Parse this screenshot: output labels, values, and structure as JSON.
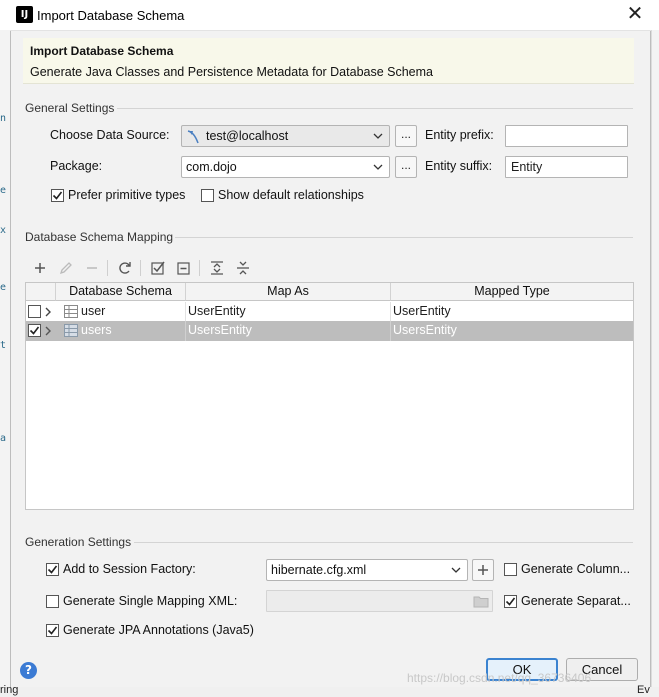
{
  "window": {
    "title": "Import Database Schema",
    "app_icon": "IJ"
  },
  "header": {
    "title": "Import Database Schema",
    "subtitle": "Generate Java Classes and Persistence Metadata for Database Schema"
  },
  "general": {
    "section_label": "General Settings",
    "data_source_label": "Choose Data Source:",
    "data_source_value": "test@localhost",
    "package_label": "Package:",
    "package_value": "com.dojo",
    "entity_prefix_label": "Entity prefix:",
    "entity_prefix_value": "",
    "entity_suffix_label": "Entity suffix:",
    "entity_suffix_value": "Entity",
    "browse_label": "...",
    "prefer_primitive_label": "Prefer primitive types",
    "prefer_primitive_checked": true,
    "show_relationships_label": "Show default relationships",
    "show_relationships_checked": false
  },
  "mapping": {
    "section_label": "Database Schema Mapping",
    "columns": [
      "Database Schema",
      "Map As",
      "Mapped Type"
    ],
    "rows": [
      {
        "checked": false,
        "name": "user",
        "map_as": "UserEntity",
        "mapped_type": "UserEntity",
        "selected": false
      },
      {
        "checked": true,
        "name": "users",
        "map_as": "UsersEntity",
        "mapped_type": "UsersEntity",
        "selected": true
      }
    ]
  },
  "generation": {
    "section_label": "Generation Settings",
    "session_factory_label": "Add to Session Factory:",
    "session_factory_checked": true,
    "session_factory_value": "hibernate.cfg.xml",
    "single_mapping_label": "Generate Single Mapping XML:",
    "single_mapping_checked": false,
    "single_mapping_value": "",
    "jpa_label": "Generate JPA Annotations (Java5)",
    "jpa_checked": true,
    "generate_column_label": "Generate Column...",
    "generate_column_checked": false,
    "generate_separate_label": "Generate Separat...",
    "generate_separate_checked": true
  },
  "buttons": {
    "ok": "OK",
    "cancel": "Cancel",
    "help": "?"
  },
  "watermark": "https://blog.csdn.net/qq_36736406",
  "ide_background": {
    "bottom_left_text": "ring",
    "bottom_right_text": "Ev"
  },
  "colors": {
    "header_bg": "#f8f8ea",
    "selection_bg": "#bdbdbd",
    "ok_border": "#3b83d0",
    "help_icon": "#3b7bd4"
  }
}
